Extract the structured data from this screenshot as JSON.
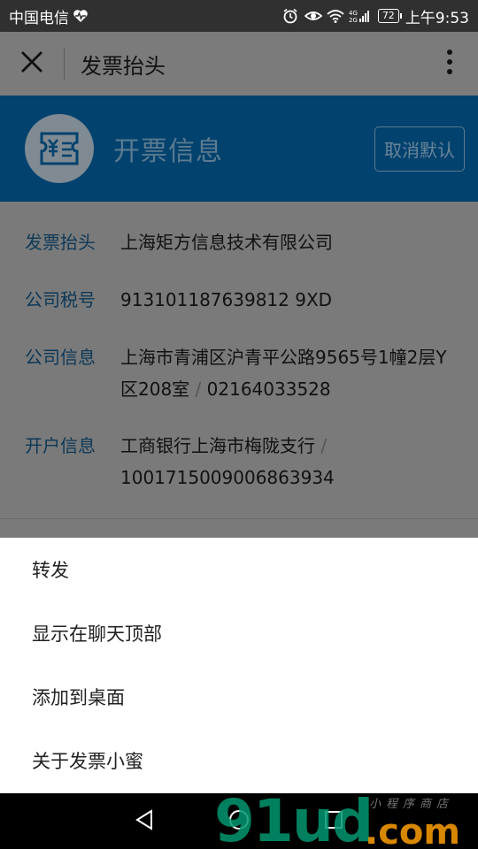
{
  "status_bar": {
    "carrier": "中国电信",
    "battery": "72",
    "time": "上午9:53"
  },
  "app_bar": {
    "title": "发票抬头"
  },
  "banner": {
    "title": "开票信息",
    "button_label": "取消默认"
  },
  "info": {
    "rows": [
      {
        "label": "发票抬头",
        "value": "上海矩方信息技术有限公司"
      },
      {
        "label": "公司税号",
        "value": "913101187639812 9XD"
      },
      {
        "label": "公司信息",
        "value_a": "上海市青浦区沪青平公路9565号1幢2层Y区208室",
        "separator": "/",
        "value_b": "02164033528"
      },
      {
        "label": "开户信息",
        "value_a": "工商银行上海市梅陇支行",
        "separator": "/",
        "value_b": "1001715009006863934"
      }
    ]
  },
  "sheet": {
    "items": [
      "转发",
      "显示在聊天顶部",
      "添加到桌面",
      "关于发票小蜜"
    ]
  },
  "watermark": {
    "main": "91ud",
    "domain": ".com",
    "sub": "小程序商店"
  }
}
